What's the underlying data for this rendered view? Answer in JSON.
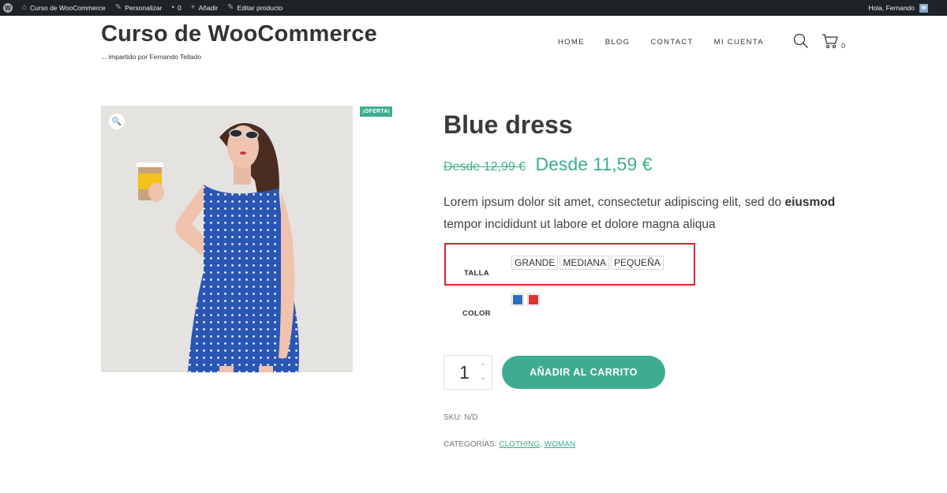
{
  "adminbar": {
    "site_name": "Curso de WooCommerce",
    "customize": "Personalizar",
    "comments_count": "0",
    "add_new": "Añadir",
    "edit_product": "Editar producto",
    "greeting": "Hola, Fernando"
  },
  "header": {
    "site_title": "Curso de WooCommerce",
    "site_description": "... impartido por Fernando Tellado",
    "nav": [
      "HOME",
      "BLOG",
      "CONTACT",
      "MI CUENTA"
    ],
    "cart_count": "0"
  },
  "product": {
    "sale_badge": "¡OFERTA!",
    "title": "Blue dress",
    "price_old": "Desde 12,99 €",
    "price_new": "Desde 11,59 €",
    "desc_part1": "Lorem ipsum dolor sit amet, consectetur adipiscing elit, sed do ",
    "desc_bold": "eiusmod",
    "desc_part2": " tempor incididunt ut labore et dolore magna aliqua",
    "attributes": {
      "size_label": "TALLA",
      "size_options": [
        "GRANDE",
        "MEDIANA",
        "PEQUEÑA"
      ],
      "color_label": "COLOR",
      "color_swatches": [
        "#2f6ebf",
        "#df3333"
      ]
    },
    "quantity": "1",
    "add_to_cart": "AÑADIR AL CARRITO",
    "sku_label": "SKU:",
    "sku_value": "N/D",
    "categories_label": "CATEGORÍAS:",
    "categories": [
      "CLOTHING",
      "WOMAN"
    ]
  },
  "colors": {
    "accent": "#3ead8f",
    "adminbar_bg": "#1d2327",
    "highlight": "#e0242a",
    "dress_blue": "#2a56b5",
    "cup_yellow": "#f2c318"
  }
}
